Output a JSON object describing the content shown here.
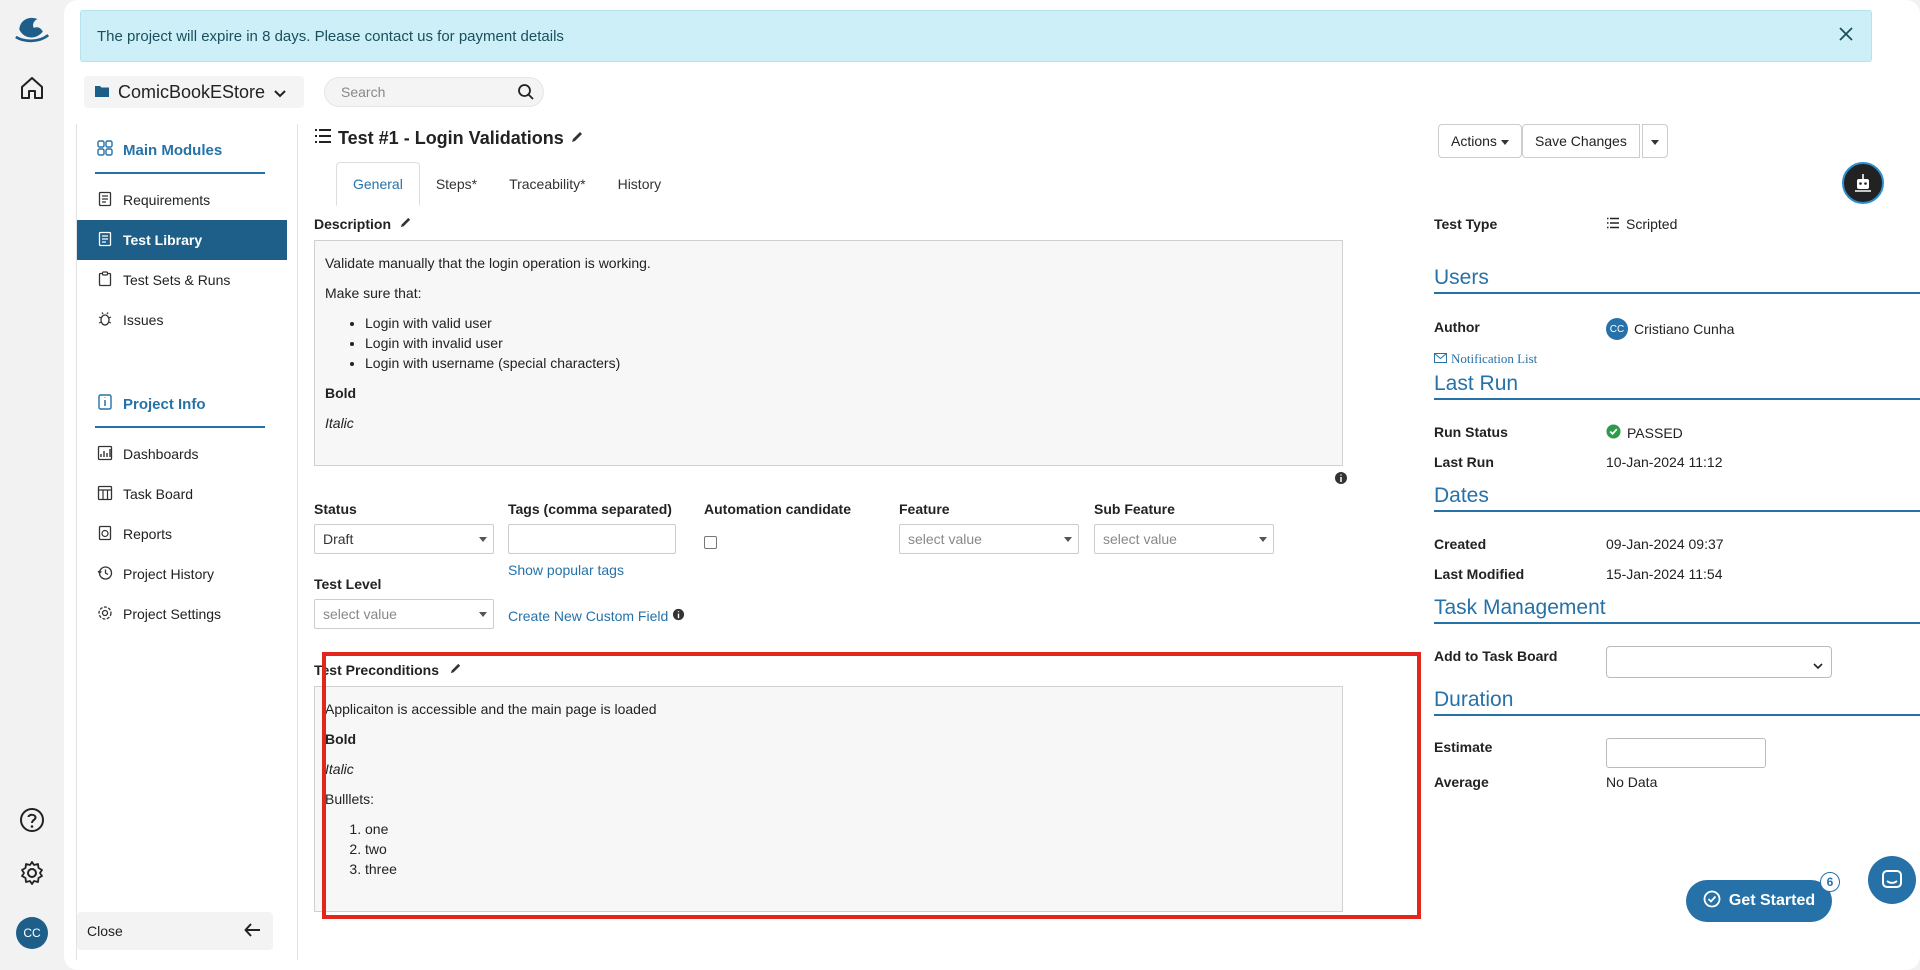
{
  "banner": {
    "text": "The project will expire in 8 days. Please contact us for payment details"
  },
  "project": {
    "name": "ComicBookEStore"
  },
  "search": {
    "placeholder": "Search"
  },
  "sidebar": {
    "main_modules": "Main Modules",
    "items": [
      {
        "label": "Requirements"
      },
      {
        "label": "Test Library"
      },
      {
        "label": "Test Sets & Runs"
      },
      {
        "label": "Issues"
      }
    ],
    "project_info": "Project Info",
    "info_items": [
      {
        "label": "Dashboards"
      },
      {
        "label": "Task Board"
      },
      {
        "label": "Reports"
      },
      {
        "label": "Project History"
      },
      {
        "label": "Project Settings"
      }
    ],
    "close_label": "Close"
  },
  "user": {
    "initials": "CC"
  },
  "test": {
    "title": "Test #1 -  Login Validations",
    "actions_label": "Actions",
    "save_label": "Save Changes",
    "tabs": [
      {
        "label": "General"
      },
      {
        "label": "Steps*"
      },
      {
        "label": "Traceability*"
      },
      {
        "label": "History"
      }
    ],
    "description_label": "Description",
    "description": {
      "line1": "Validate manually that the login operation is working.",
      "line2": "Make sure that:",
      "bullets": [
        "Login with valid user",
        "Login with invalid user",
        "Login with username (special characters)"
      ],
      "bold": "Bold",
      "italic": "Italic"
    },
    "status_label": "Status",
    "status_value": "Draft",
    "tags_label": "Tags (comma separated)",
    "show_tags": "Show popular tags",
    "automation_label": "Automation candidate",
    "feature_label": "Feature",
    "feature_placeholder": "select value",
    "subfeature_label": "Sub Feature",
    "subfeature_placeholder": "select value",
    "level_label": "Test Level",
    "level_placeholder": "select value",
    "create_field": "Create New Custom Field",
    "preconditions_label": "Test Preconditions",
    "preconditions": {
      "line1": "Applicaiton is accessible and the main page is loaded",
      "bold": "Bold",
      "italic": "Italic",
      "bullets_label": "Bulllets:",
      "items": [
        "one",
        "two",
        "three"
      ]
    }
  },
  "details": {
    "test_type_label": "Test Type",
    "test_type_value": "Scripted",
    "users_head": "Users",
    "author_label": "Author",
    "author_initials": "CC",
    "author_value": "Cristiano Cunha",
    "notification_list": "Notification List",
    "last_run_head": "Last Run",
    "run_status_label": "Run Status",
    "run_status_value": "PASSED",
    "last_run_label": "Last Run",
    "last_run_value": "10-Jan-2024 11:12",
    "dates_head": "Dates",
    "created_label": "Created",
    "created_value": "09-Jan-2024 09:37",
    "modified_label": "Last Modified",
    "modified_value": "15-Jan-2024 11:54",
    "task_head": "Task Management",
    "add_task_label": "Add to Task Board",
    "duration_head": "Duration",
    "estimate_label": "Estimate",
    "average_label": "Average",
    "average_value": "No Data"
  },
  "get_started": {
    "label": "Get Started",
    "badge": "6"
  },
  "colors": {
    "accent": "#2672a8",
    "active_nav": "#1e5f8a",
    "banner_bg": "#cdeff8",
    "highlight": "#e3261c",
    "passed": "#2e9b4a"
  }
}
